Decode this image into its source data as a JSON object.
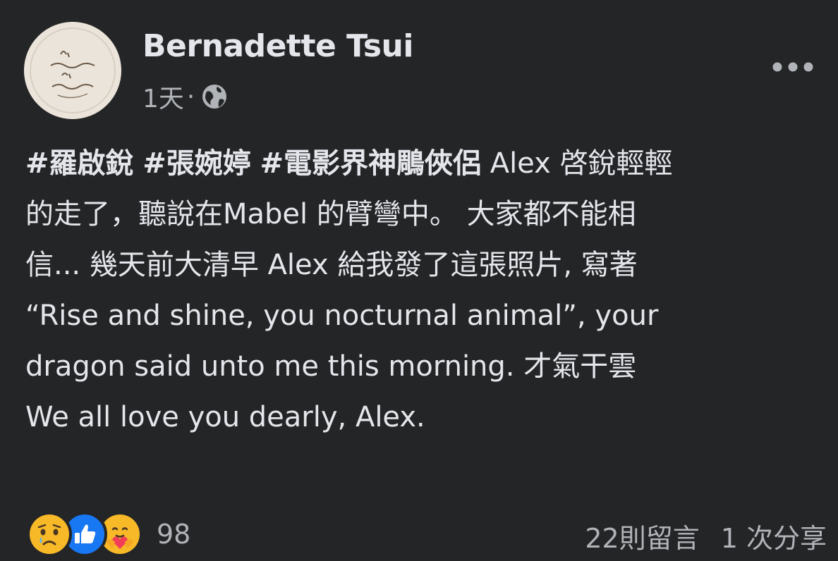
{
  "header": {
    "author_name": "Bernadette Tsui",
    "timestamp": "1天",
    "separator": "·",
    "privacy_icon": "globe-icon",
    "more_icon": "more-options-icon"
  },
  "post": {
    "hashtags": [
      "#羅啟銳",
      "#張婉婷",
      "#電影界神鵰俠侶"
    ],
    "line1_rest": " Alex 啓銳輕輕",
    "line2": "的走了，聽說在Mabel 的臂彎中。 大家都不能相",
    "line3": "信... 幾天前大清早 Alex 給我發了這張照片, 寫著",
    "line4": "“Rise and shine, you nocturnal animal”, your",
    "line5": "dragon said unto me this morning. 才氣干雲",
    "line6": "We all love you dearly, Alex."
  },
  "footer": {
    "reaction_icons": [
      "sad-icon",
      "like-icon",
      "care-icon"
    ],
    "reaction_count": "98",
    "comments": "22則留言",
    "shares": "1 次分享"
  },
  "colors": {
    "background": "#242526",
    "primary_text": "#e4e6eb",
    "secondary_text": "#b0b3b8",
    "like_blue": "#1877f2",
    "reaction_yellow": "#f7b928"
  }
}
